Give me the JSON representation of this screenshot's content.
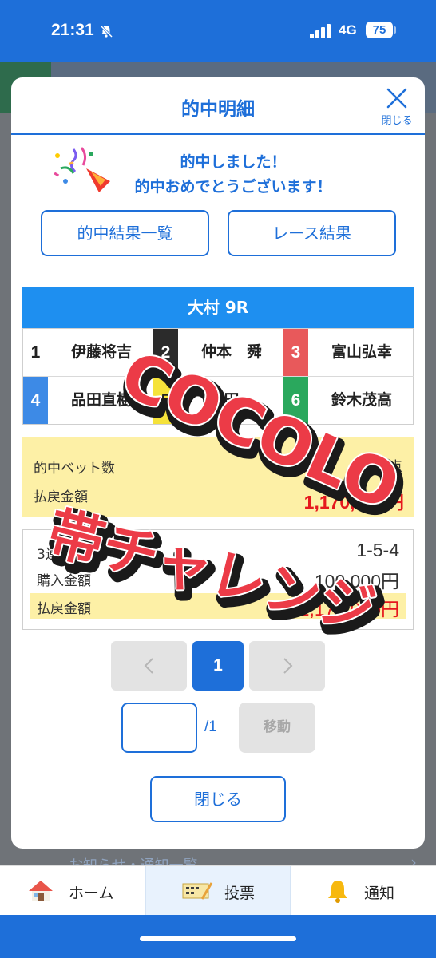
{
  "status_bar": {
    "time": "21:31",
    "network": "4G",
    "battery": "75"
  },
  "background": {
    "notice_text": "お知らせ・通知一覧",
    "notice_arrow": "›"
  },
  "modal": {
    "title": "的中明細",
    "close_label": "閉じる",
    "message_line1": "的中しました！",
    "message_line2": "的中おめでとうございます！",
    "buttons": {
      "results_list": "的中結果一覧",
      "race_result": "レース結果"
    },
    "race": {
      "name": "大村 9R",
      "racers": [
        {
          "number": "1",
          "name": "伊藤将吉",
          "color": "#ffffff",
          "text_color": "#222222"
        },
        {
          "number": "2",
          "name": "仲本　舜",
          "color": "#2b2b2b",
          "text_color": "#ffffff"
        },
        {
          "number": "3",
          "name": "富山弘幸",
          "color": "#e8595b",
          "text_color": "#ffffff"
        },
        {
          "number": "4",
          "name": "品田直樹",
          "color": "#3d8ae6",
          "text_color": "#ffffff"
        },
        {
          "number": "5",
          "name": "田",
          "color": "#f5e23a",
          "text_color": "#222222"
        },
        {
          "number": "6",
          "name": "鈴木茂高",
          "color": "#2aa85d",
          "text_color": "#ffffff"
        }
      ]
    },
    "summary": {
      "bet_count_label": "的中ベット数",
      "bet_count_value": "1点",
      "payout_label": "払戻金額",
      "payout_value": "1,170,000円"
    },
    "bet_detail": {
      "combo_label": "3連単",
      "combo_value": "1-5-4",
      "purchase_label": "購入金額",
      "purchase_value": "100,000円",
      "payout_label": "払戻金額",
      "payout_value": "1,170,000円"
    },
    "pager": {
      "prev": "‹",
      "current": "1",
      "next": "›",
      "total": "/1",
      "move_label": "移動",
      "input_value": ""
    },
    "close_button": "閉じる"
  },
  "watermark": {
    "line1": "COCOLO",
    "line2": "帯チャレンジ",
    "color": "#ec3b47"
  },
  "bottom_nav": {
    "items": [
      {
        "label": "ホーム",
        "icon": "home-icon"
      },
      {
        "label": "投票",
        "icon": "ticket-icon"
      },
      {
        "label": "通知",
        "icon": "bell-icon"
      }
    ]
  },
  "colors": {
    "accent": "#1e6fd9",
    "highlight": "#fdf0a6",
    "payout_red": "#e6191e"
  }
}
